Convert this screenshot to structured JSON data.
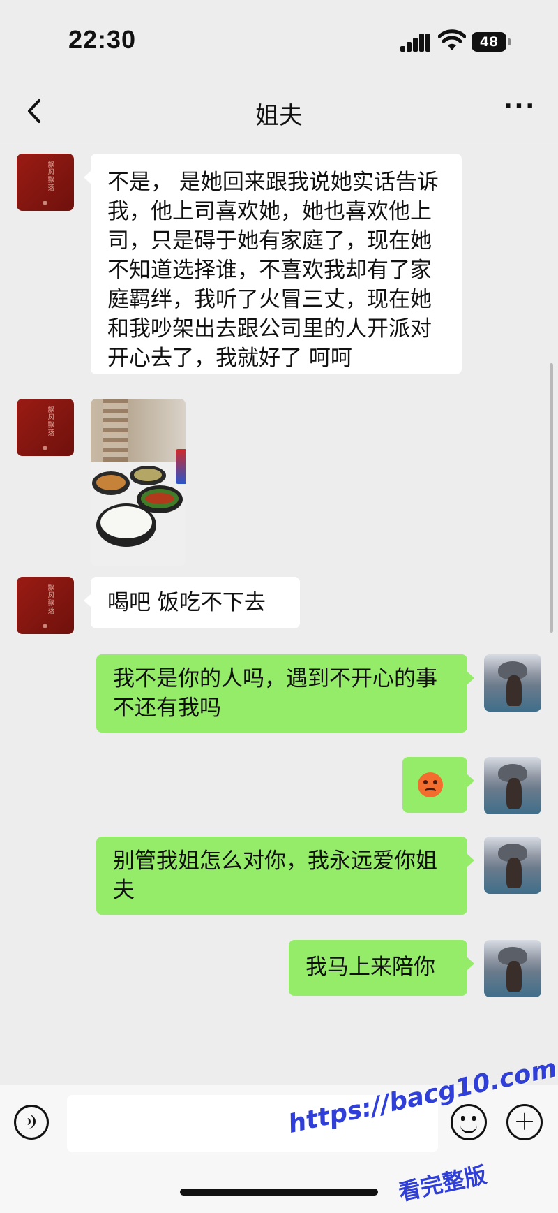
{
  "status_bar": {
    "time": "22:30",
    "battery": "48"
  },
  "header": {
    "title": "姐夫",
    "more_label": "···"
  },
  "messages": [
    {
      "side": "in",
      "type": "text",
      "text": "不是， 是她回来跟我说她实话告诉我，他上司喜欢她，她也喜欢他上司，只是碍于她有家庭了，现在她不知道选择谁，不喜欢我却有了家庭羁绊，我听了火冒三丈，现在她和我吵架出去跟公司里的人开派对开心去了，我就好了 呵呵"
    },
    {
      "side": "in",
      "type": "image",
      "description": ""
    },
    {
      "side": "in",
      "type": "text",
      "text": "喝吧 饭吃不下去"
    },
    {
      "side": "out",
      "type": "text",
      "text": "我不是你的人吗，遇到不开心的事不还有我吗"
    },
    {
      "side": "out",
      "type": "emoji",
      "icon": "angry-face-emoji"
    },
    {
      "side": "out",
      "type": "text",
      "text": "别管我姐怎么对你，我永远爱你姐夫"
    },
    {
      "side": "out",
      "type": "text",
      "text": "我马上来陪你"
    }
  ],
  "avatars": {
    "contact_text": "飘风飘落"
  },
  "input_bar": {
    "placeholder": ""
  },
  "watermark": {
    "line1": "https://bacg10.com",
    "line2": "看完整版"
  },
  "colors": {
    "background": "#ededed",
    "outgoing_bubble": "#95ec69",
    "incoming_bubble": "#ffffff",
    "watermark": "#2f3fd8"
  }
}
